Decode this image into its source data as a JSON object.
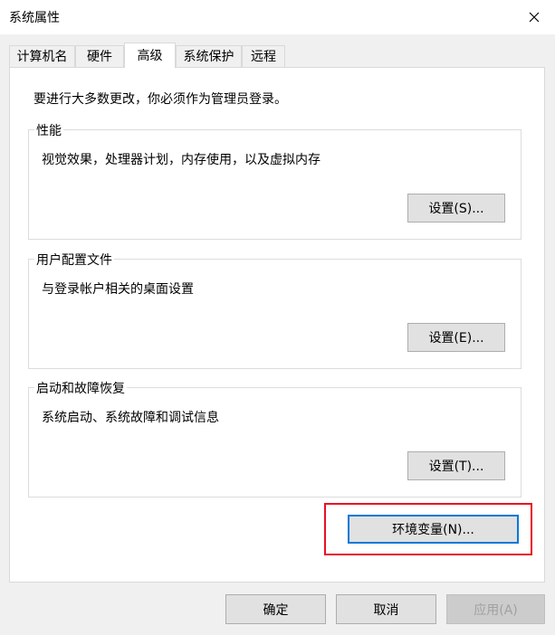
{
  "window": {
    "title": "系统属性"
  },
  "tabs": [
    {
      "label": "计算机名"
    },
    {
      "label": "硬件"
    },
    {
      "label": "高级",
      "active": true
    },
    {
      "label": "系统保护"
    },
    {
      "label": "远程"
    }
  ],
  "advanced": {
    "intro": "要进行大多数更改，你必须作为管理员登录。",
    "performance": {
      "title": "性能",
      "description": "视觉效果，处理器计划，内存使用，以及虚拟内存",
      "button": "设置(S)..."
    },
    "user_profiles": {
      "title": "用户配置文件",
      "description": "与登录帐户相关的桌面设置",
      "button": "设置(E)..."
    },
    "startup_recovery": {
      "title": "启动和故障恢复",
      "description": "系统启动、系统故障和调试信息",
      "button": "设置(T)..."
    },
    "env_vars_button": "环境变量(N)..."
  },
  "footer": {
    "ok": "确定",
    "cancel": "取消",
    "apply": "应用(A)"
  },
  "colors": {
    "highlight": "#e81123",
    "focus": "#0078d7"
  }
}
